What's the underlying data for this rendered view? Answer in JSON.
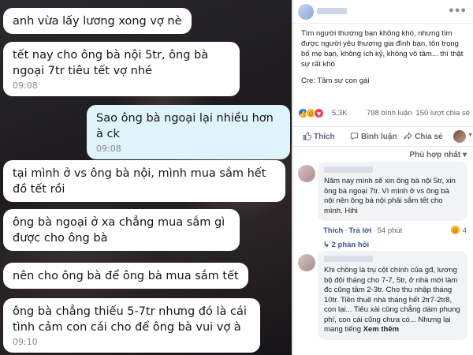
{
  "chat": {
    "messages": [
      {
        "dir": "in",
        "text": "anh vừa lấy lương xong vợ nè",
        "time": ""
      },
      {
        "dir": "in",
        "text": "tết nay cho ông bà nội 5tr, ông bà ngoại 7tr tiêu tết vợ nhé",
        "time": "09:08"
      },
      {
        "dir": "out",
        "text": "Sao ông bà ngoại lại nhiều hơn à ck",
        "time": "09:08"
      },
      {
        "dir": "in",
        "text": "tại mình ở vs ông bà nội, mình mua sắm hết đồ tết rồi",
        "time": ""
      },
      {
        "dir": "in",
        "text": "ông bà ngoại ở xa chẳng mua sắm gì được cho ông bà",
        "time": ""
      },
      {
        "dir": "in",
        "text": "nên cho ông bà để ông bà mua sắm tết",
        "time": ""
      },
      {
        "dir": "in",
        "text": "ông bà chẳng thiếu 5-7tr nhưng đó là cái tình cảm con cái cho để ông bà vui vợ à",
        "time": "09:10"
      }
    ]
  },
  "post": {
    "text": "Tìm người thương bạn không khó, nhưng tìm được người yêu thương gia đình bạn, tôn trọng bố mẹ bạn, không ích kỷ, không vô tâm... thì thật sự rất khó",
    "source": "Cre: Tâm sự con gái",
    "reaction_count": "5,3K",
    "comment_count": "798 bình luận",
    "share_count": "150 lượt chia sẻ",
    "actions": {
      "like": "Thích",
      "comment": "Bình luận",
      "share": "Chia sẻ"
    },
    "sort_label": "Phù hợp nhất",
    "sort_caret": "▾"
  },
  "comments": [
    {
      "text": "Năm nay mình sẽ xin ông bà nội 5tr, xin ông bà ngoại 7tr. Vì mình ở vs ông bà nội nên ông bà nội phải sắm tết cho mình. Hihi",
      "like": "Thích",
      "reply": "Trả lời",
      "time": "54 phút",
      "reaction_count": "4",
      "replies_link": "2 phản hồi"
    },
    {
      "text": "Khi chồng là trụ cột chính của gđ, lương bộ đội tháng cho 7-7, 5tr, ở nhà mới làm đc cũng tầm 2-3tr. Cho thu nhập tháng 10tr. Tiền thuê nhà tháng hết 2tr7-2tr8, con lại... Tiêu xài cũng chẳng dám phung phí, con cái cũng chưa có... Nhưng lại mang tiếng",
      "see_more": "Xem thêm"
    }
  ],
  "icons": {
    "like_color": "#1877f2",
    "haha_color": "#f7b928",
    "love_color": "#f33e58"
  }
}
